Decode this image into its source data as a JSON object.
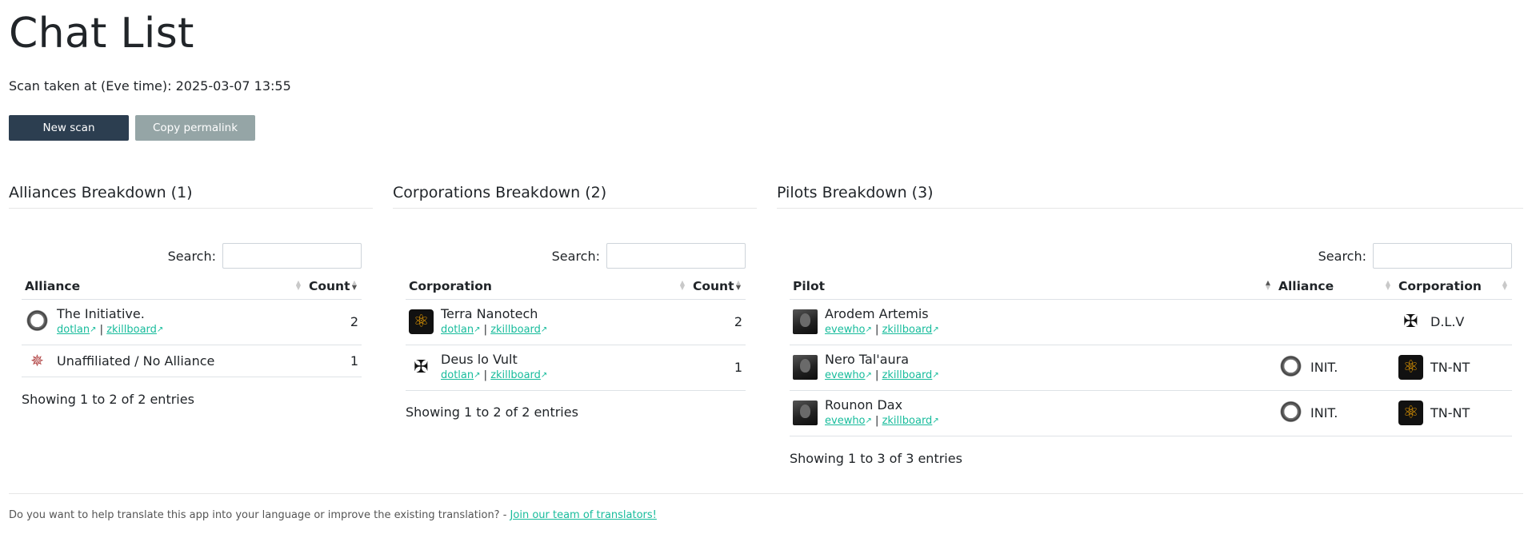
{
  "page_title": "Chat List",
  "scan_time": "Scan taken at (Eve time): 2025-03-07 13:55",
  "buttons": {
    "new_scan": "New scan",
    "copy_permalink": "Copy permalink"
  },
  "search_label": "Search:",
  "link_labels": {
    "dotlan": "dotlan",
    "zkillboard": "zkillboard",
    "evewho": "evewho",
    "separator": "|"
  },
  "colors": {
    "primary": "#2c3e50",
    "secondary": "#95a5a6",
    "link": "#18bc9c"
  },
  "alliances": {
    "heading": "Alliances Breakdown (1)",
    "columns": {
      "name": "Alliance",
      "count": "Count"
    },
    "rows": [
      {
        "name": "The Initiative.",
        "count": "2",
        "icon": "initiative-logo-icon",
        "has_links": true
      },
      {
        "name": "Unaffiliated / No Alliance",
        "count": "1",
        "icon": "unaffiliated-icon",
        "has_links": false
      }
    ],
    "showing": "Showing 1 to 2 of 2 entries"
  },
  "corporations": {
    "heading": "Corporations Breakdown (2)",
    "columns": {
      "name": "Corporation",
      "count": "Count"
    },
    "rows": [
      {
        "name": "Terra Nanotech",
        "count": "2",
        "icon": "atom-logo-icon"
      },
      {
        "name": "Deus lo Vult",
        "count": "1",
        "icon": "cross-logo-icon"
      }
    ],
    "showing": "Showing 1 to 2 of 2 entries"
  },
  "pilots": {
    "heading": "Pilots Breakdown (3)",
    "columns": {
      "pilot": "Pilot",
      "alliance": "Alliance",
      "corporation": "Corporation"
    },
    "rows": [
      {
        "name": "Arodem Artemis",
        "alliance": "",
        "corporation": "D.L.V",
        "corp_icon": "cross-logo-icon"
      },
      {
        "name": "Nero Tal'aura",
        "alliance": "INIT.",
        "corporation": "TN-NT",
        "corp_icon": "atom-logo-icon"
      },
      {
        "name": "Rounon Dax",
        "alliance": "INIT.",
        "corporation": "TN-NT",
        "corp_icon": "atom-logo-icon"
      }
    ],
    "showing": "Showing 1 to 3 of 3 entries"
  },
  "footer": {
    "text": "Do you want to help translate this app into your language or improve the existing translation? -",
    "link": "Join our team of translators!"
  }
}
